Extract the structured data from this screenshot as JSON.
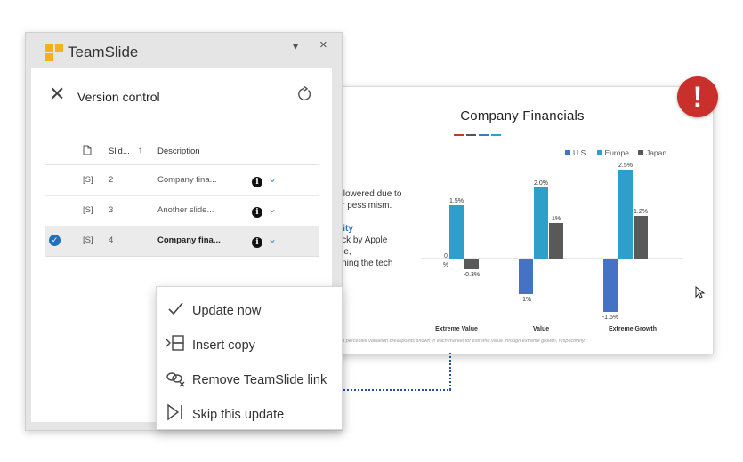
{
  "pane": {
    "app_name": "TeamSlide",
    "dropdown_glyph": "▾",
    "close_glyph": "×",
    "panel_title": "Version control",
    "columns": {
      "num": "Slid...",
      "sort": "↑",
      "description": "Description"
    },
    "rows": [
      {
        "type": "[S]",
        "num": "2",
        "description": "Company fina...",
        "selected": false
      },
      {
        "type": "[S]",
        "num": "3",
        "description": "Another slide...",
        "selected": false
      },
      {
        "type": "[S]",
        "num": "4",
        "description": "Company fina...",
        "selected": true
      }
    ],
    "info_glyph": "i",
    "chevron_glyph": "⌄",
    "check_glyph": "✓"
  },
  "menu": {
    "items": [
      {
        "label": "Update now",
        "icon": "checkmark-icon"
      },
      {
        "label": "Insert copy",
        "icon": "insert-copy-icon"
      },
      {
        "label": "Remove TeamSlide link",
        "icon": "unlink-icon"
      },
      {
        "label": "Skip this update",
        "icon": "skip-icon"
      }
    ]
  },
  "alert": {
    "glyph": "!"
  },
  "slide": {
    "title": "Company Financials",
    "text_lines": [
      "ks lowered due to",
      "her pessimism."
    ],
    "highlight": "unity",
    "text_lines2": [
      " back by Apple",
      "ogle,",
      "hening the tech"
    ],
    "footnote": "...th percentile valuation breakpoints shown in each market for extreme value through extreme growth, respectively.",
    "colors": {
      "us": "#4472c4",
      "europe": "#2e9fc9",
      "japan": "#595959",
      "accent_red": "#c0392b"
    }
  },
  "chart_data": {
    "type": "bar",
    "categories": [
      "Extreme Value",
      "Value",
      "Extreme Growth"
    ],
    "series": [
      {
        "name": "U.S.",
        "values": [
          0,
          -1,
          -1.5
        ],
        "labels": [
          "",
          "-1%",
          "-1.5%"
        ]
      },
      {
        "name": "Europe",
        "values": [
          1.5,
          2.0,
          2.5
        ],
        "labels": [
          "1.5%",
          "2.0%",
          "2.5%"
        ]
      },
      {
        "name": "Japan",
        "values": [
          -0.3,
          1,
          1.2
        ],
        "labels": [
          "-0.3%",
          "1%",
          "1.2%"
        ]
      }
    ],
    "ytick_zero": "0",
    "yunit": "%",
    "ylim": [
      -1.8,
      2.7
    ],
    "legend": "top-right"
  }
}
